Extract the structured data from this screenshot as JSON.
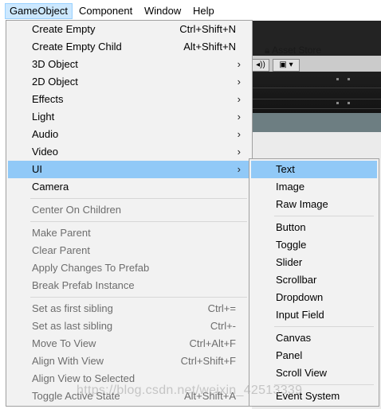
{
  "menubar": {
    "items": [
      "GameObject",
      "Component",
      "Window",
      "Help"
    ]
  },
  "editor": {
    "asset_store": "Asset Store",
    "audio_button": "◂))",
    "image_button": "▣ ▾"
  },
  "gameobject_menu": {
    "groups": [
      [
        {
          "label": "Create Empty",
          "shortcut": "Ctrl+Shift+N",
          "arrow": false,
          "disabled": false
        },
        {
          "label": "Create Empty Child",
          "shortcut": "Alt+Shift+N",
          "arrow": false,
          "disabled": false
        },
        {
          "label": "3D Object",
          "shortcut": "",
          "arrow": true,
          "disabled": false
        },
        {
          "label": "2D Object",
          "shortcut": "",
          "arrow": true,
          "disabled": false
        },
        {
          "label": "Effects",
          "shortcut": "",
          "arrow": true,
          "disabled": false
        },
        {
          "label": "Light",
          "shortcut": "",
          "arrow": true,
          "disabled": false
        },
        {
          "label": "Audio",
          "shortcut": "",
          "arrow": true,
          "disabled": false
        },
        {
          "label": "Video",
          "shortcut": "",
          "arrow": true,
          "disabled": false
        },
        {
          "label": "UI",
          "shortcut": "",
          "arrow": true,
          "disabled": false,
          "highlighted": true
        },
        {
          "label": "Camera",
          "shortcut": "",
          "arrow": false,
          "disabled": false
        }
      ],
      [
        {
          "label": "Center On Children",
          "shortcut": "",
          "arrow": false,
          "disabled": true
        }
      ],
      [
        {
          "label": "Make Parent",
          "shortcut": "",
          "arrow": false,
          "disabled": true
        },
        {
          "label": "Clear Parent",
          "shortcut": "",
          "arrow": false,
          "disabled": true
        },
        {
          "label": "Apply Changes To Prefab",
          "shortcut": "",
          "arrow": false,
          "disabled": true
        },
        {
          "label": "Break Prefab Instance",
          "shortcut": "",
          "arrow": false,
          "disabled": true
        }
      ],
      [
        {
          "label": "Set as first sibling",
          "shortcut": "Ctrl+=",
          "arrow": false,
          "disabled": true
        },
        {
          "label": "Set as last sibling",
          "shortcut": "Ctrl+-",
          "arrow": false,
          "disabled": true
        },
        {
          "label": "Move To View",
          "shortcut": "Ctrl+Alt+F",
          "arrow": false,
          "disabled": true
        },
        {
          "label": "Align With View",
          "shortcut": "Ctrl+Shift+F",
          "arrow": false,
          "disabled": true
        },
        {
          "label": "Align View to Selected",
          "shortcut": "",
          "arrow": false,
          "disabled": true
        },
        {
          "label": "Toggle Active State",
          "shortcut": "Alt+Shift+A",
          "arrow": false,
          "disabled": true
        }
      ]
    ]
  },
  "ui_submenu": {
    "groups": [
      [
        {
          "label": "Text",
          "highlighted": true
        },
        {
          "label": "Image"
        },
        {
          "label": "Raw Image"
        }
      ],
      [
        {
          "label": "Button"
        },
        {
          "label": "Toggle"
        },
        {
          "label": "Slider"
        },
        {
          "label": "Scrollbar"
        },
        {
          "label": "Dropdown"
        },
        {
          "label": "Input Field"
        }
      ],
      [
        {
          "label": "Canvas"
        },
        {
          "label": "Panel"
        },
        {
          "label": "Scroll View"
        }
      ],
      [
        {
          "label": "Event System"
        }
      ]
    ]
  },
  "watermark": "https://blog.csdn.net/weixin_42513339",
  "colors": {
    "highlight": "#91c9f7",
    "menubar_active": "#cce8ff",
    "menu_bg": "#f2f2f2",
    "disabled_text": "#6d6d6d"
  }
}
